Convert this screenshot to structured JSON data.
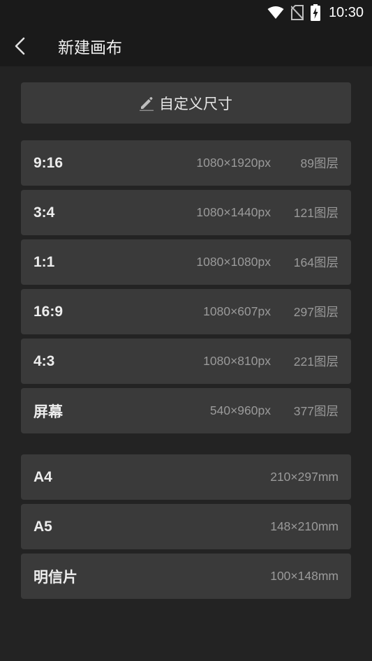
{
  "status_bar": {
    "time": "10:30",
    "icons": [
      "wifi-icon",
      "no-sim-icon",
      "battery-charging-icon"
    ]
  },
  "app_bar": {
    "title": "新建画布",
    "back_icon": "chevron-left-icon"
  },
  "custom_size": {
    "label": "自定义尺寸",
    "icon": "pencil-icon"
  },
  "presets": [
    {
      "ratio": "9:16",
      "size": "1080×1920px",
      "layers": "89图层"
    },
    {
      "ratio": "3:4",
      "size": "1080×1440px",
      "layers": "121图层"
    },
    {
      "ratio": "1:1",
      "size": "1080×1080px",
      "layers": "164图层"
    },
    {
      "ratio": "16:9",
      "size": "1080×607px",
      "layers": "297图层"
    },
    {
      "ratio": "4:3",
      "size": "1080×810px",
      "layers": "221图层"
    },
    {
      "ratio": "屏幕",
      "size": "540×960px",
      "layers": "377图层"
    }
  ],
  "paper_sizes": [
    {
      "name": "A4",
      "size": "210×297mm"
    },
    {
      "name": "A5",
      "size": "148×210mm"
    },
    {
      "name": "明信片",
      "size": "100×148mm"
    }
  ],
  "colors": {
    "background": "#232323",
    "bar": "#1a1a1a",
    "card": "#3a3a3a",
    "text_primary": "#ededed",
    "text_secondary": "#9a9a9a"
  }
}
